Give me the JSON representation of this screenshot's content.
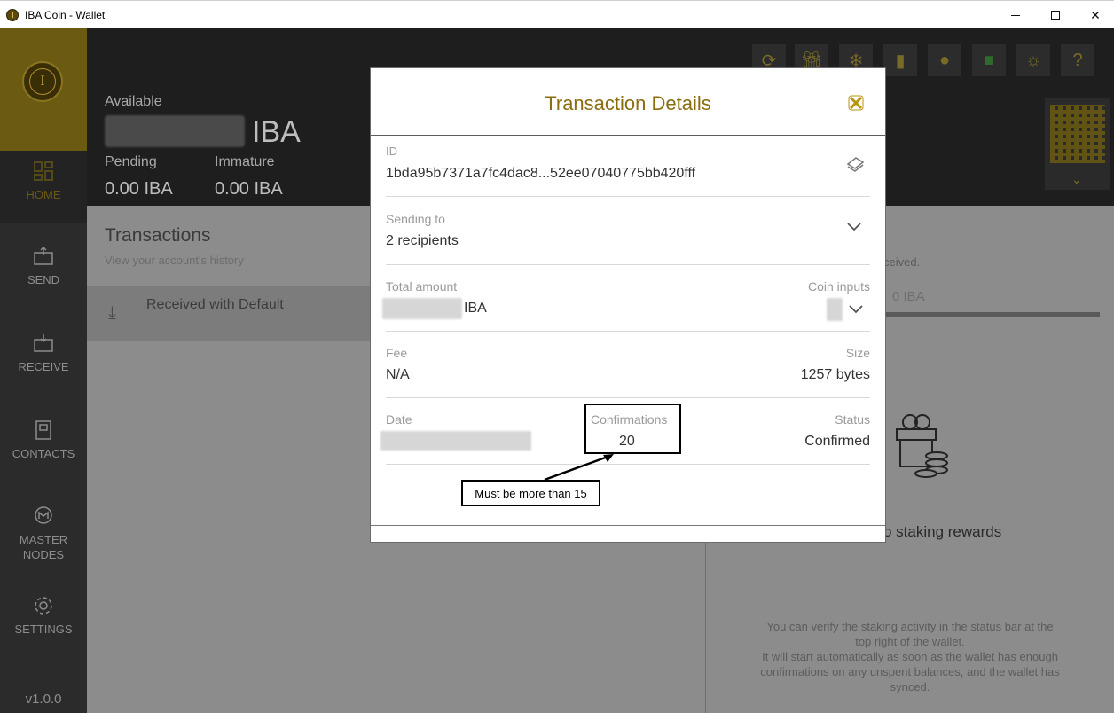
{
  "window": {
    "title": "IBA Coin - Wallet"
  },
  "sidebar": {
    "logo_letter": "I",
    "items": [
      {
        "label": "HOME",
        "icon": "home-icon"
      },
      {
        "label": "SEND",
        "icon": "wallet-send-icon"
      },
      {
        "label": "RECEIVE",
        "icon": "wallet-receive-icon"
      },
      {
        "label": "CONTACTS",
        "icon": "contacts-icon"
      },
      {
        "label": "MASTER",
        "label2": "NODES",
        "icon": "masternodes-icon"
      },
      {
        "label": "SETTINGS",
        "icon": "gear-icon"
      }
    ],
    "version": "v1.0.0"
  },
  "header": {
    "available_label": "Available",
    "available_unit": "IBA",
    "pending_label": "Pending",
    "pending_value": "0.00 IBA",
    "immature_label": "Immature",
    "immature_value": "0.00 IBA",
    "toolbar_icons": [
      "sync-icon",
      "gift-icon",
      "snowflake-icon",
      "signal-icon",
      "flame-icon",
      "lock-icon",
      "sun-icon",
      "help-icon"
    ],
    "help_symbol": "?"
  },
  "transactions": {
    "title": "Transactions",
    "subtitle": "View your account's history",
    "rows": [
      {
        "label": "Received with Default"
      }
    ]
  },
  "staking": {
    "received_text": "ceived.",
    "amount_text": "0 IBA",
    "no_rewards": "o staking rewards",
    "info_lines": [
      "You can verify the staking activity in the status bar at the",
      "top right of the wallet.",
      "It will start automatically as soon as the wallet has enough",
      "confirmations on any unspent balances, and the wallet has",
      "synced."
    ]
  },
  "modal": {
    "title": "Transaction Details",
    "id_label": "ID",
    "id_value": "1bda95b7371a7fc4dac8...52ee07040775bb420fff",
    "sending_label": "Sending to",
    "sending_value": "2 recipients",
    "total_label": "Total amount",
    "total_unit": "IBA",
    "coin_inputs_label": "Coin inputs",
    "fee_label": "Fee",
    "fee_value": "N/A",
    "size_label": "Size",
    "size_value": "1257 bytes",
    "date_label": "Date",
    "confirmations_label": "Confirmations",
    "confirmations_value": "20",
    "status_label": "Status",
    "status_value": "Confirmed"
  },
  "annotation": {
    "note": "Must be more than 15"
  },
  "colors": {
    "gold": "#8a6d10",
    "close_gold": "#b8940f",
    "sidebar": "#2b2b2b"
  }
}
